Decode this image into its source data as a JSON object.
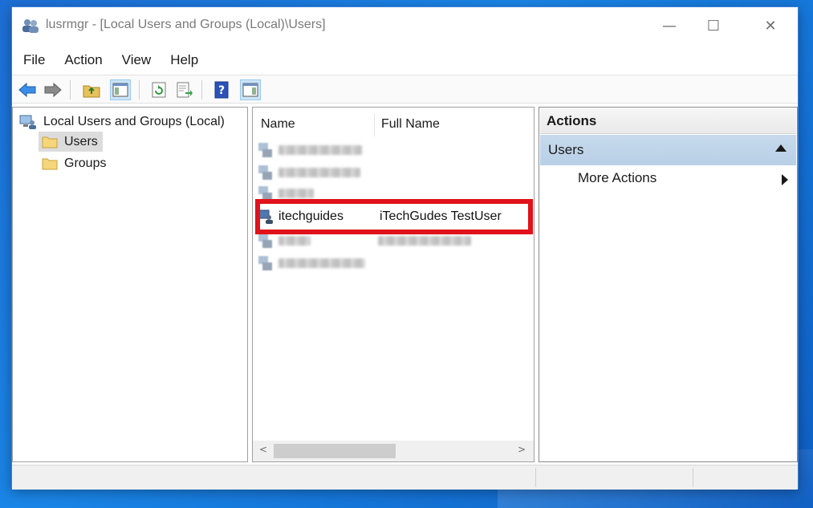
{
  "window": {
    "title": "lusrmgr - [Local Users and Groups (Local)\\Users]",
    "minimize_glyph": "—",
    "maximize_glyph": "☐",
    "close_glyph": "✕"
  },
  "menu": {
    "items": [
      "File",
      "Action",
      "View",
      "Help"
    ]
  },
  "toolbar": {
    "buttons": [
      "back-icon",
      "forward-icon",
      "up-folder-icon",
      "show-hide-tree-icon",
      "refresh-icon",
      "export-list-icon",
      "help-icon",
      "show-hide-action-pane-icon"
    ]
  },
  "tree": {
    "root_label": "Local Users and Groups (Local)",
    "children": [
      {
        "label": "Users",
        "selected": true
      },
      {
        "label": "Groups",
        "selected": false
      }
    ]
  },
  "list": {
    "columns": [
      "Name",
      "Full Name"
    ],
    "rows": [
      {
        "name": "",
        "full_name": "",
        "blurred": true
      },
      {
        "name": "",
        "full_name": "",
        "blurred": true
      },
      {
        "name": "",
        "full_name": "",
        "blurred": true
      },
      {
        "name": "itechguides",
        "full_name": "iTechGudes TestUser",
        "blurred": false
      },
      {
        "name": "",
        "full_name": "",
        "blurred": true
      },
      {
        "name": "",
        "full_name": "",
        "blurred": true
      }
    ],
    "scroll_left_glyph": "<",
    "scroll_right_glyph": ">"
  },
  "actions": {
    "header": "Actions",
    "section": "Users",
    "items": [
      "More Actions"
    ]
  },
  "colors": {
    "highlight": "#e0121a",
    "section_bg": "#c7daed",
    "selection_bg": "#dcdcdc"
  }
}
